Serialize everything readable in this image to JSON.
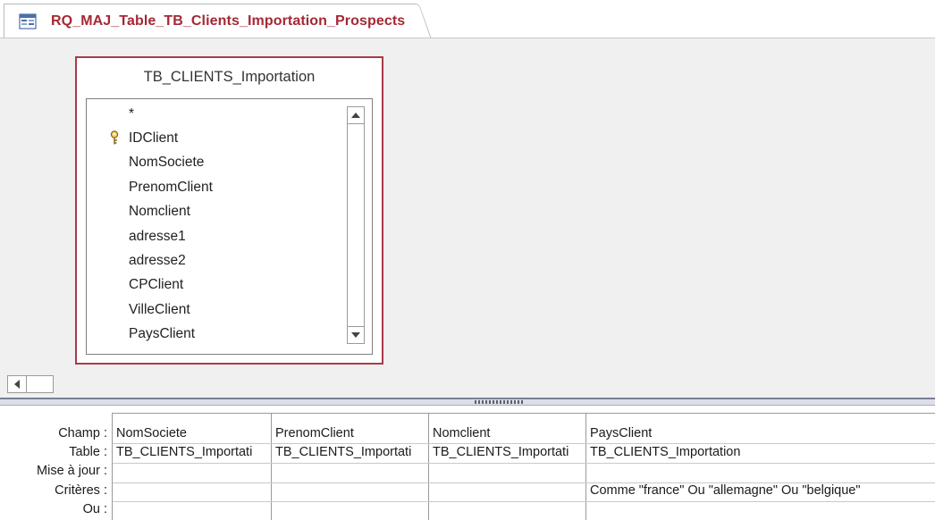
{
  "tab": {
    "title": "RQ_MAJ_Table_TB_Clients_Importation_Prospects",
    "icon": "query-icon",
    "accent_color": "#a52834"
  },
  "table_window": {
    "title": "TB_CLIENTS_Importation",
    "border_color": "#a93a48",
    "fields": [
      {
        "name": "*",
        "primary_key": false
      },
      {
        "name": "IDClient",
        "primary_key": true
      },
      {
        "name": "NomSociete",
        "primary_key": false
      },
      {
        "name": "PrenomClient",
        "primary_key": false
      },
      {
        "name": "Nomclient",
        "primary_key": false
      },
      {
        "name": "adresse1",
        "primary_key": false
      },
      {
        "name": "adresse2",
        "primary_key": false
      },
      {
        "name": "CPClient",
        "primary_key": false
      },
      {
        "name": "VilleClient",
        "primary_key": false
      },
      {
        "name": "PaysClient",
        "primary_key": false
      }
    ]
  },
  "grid": {
    "row_labels": [
      "Champ :",
      "Table :",
      "Mise à jour :",
      "Critères :",
      "Ou :"
    ],
    "columns": [
      {
        "champ": "NomSociete",
        "table": "TB_CLIENTS_Importati",
        "mise_a_jour": "",
        "criteres": "",
        "ou": ""
      },
      {
        "champ": "PrenomClient",
        "table": "TB_CLIENTS_Importati",
        "mise_a_jour": "",
        "criteres": "",
        "ou": ""
      },
      {
        "champ": "Nomclient",
        "table": "TB_CLIENTS_Importati",
        "mise_a_jour": "",
        "criteres": "",
        "ou": ""
      },
      {
        "champ": "PaysClient",
        "table": "TB_CLIENTS_Importation",
        "mise_a_jour": "",
        "criteres": "Comme \"france\" Ou \"allemagne\" Ou \"belgique\"",
        "ou": ""
      }
    ]
  }
}
